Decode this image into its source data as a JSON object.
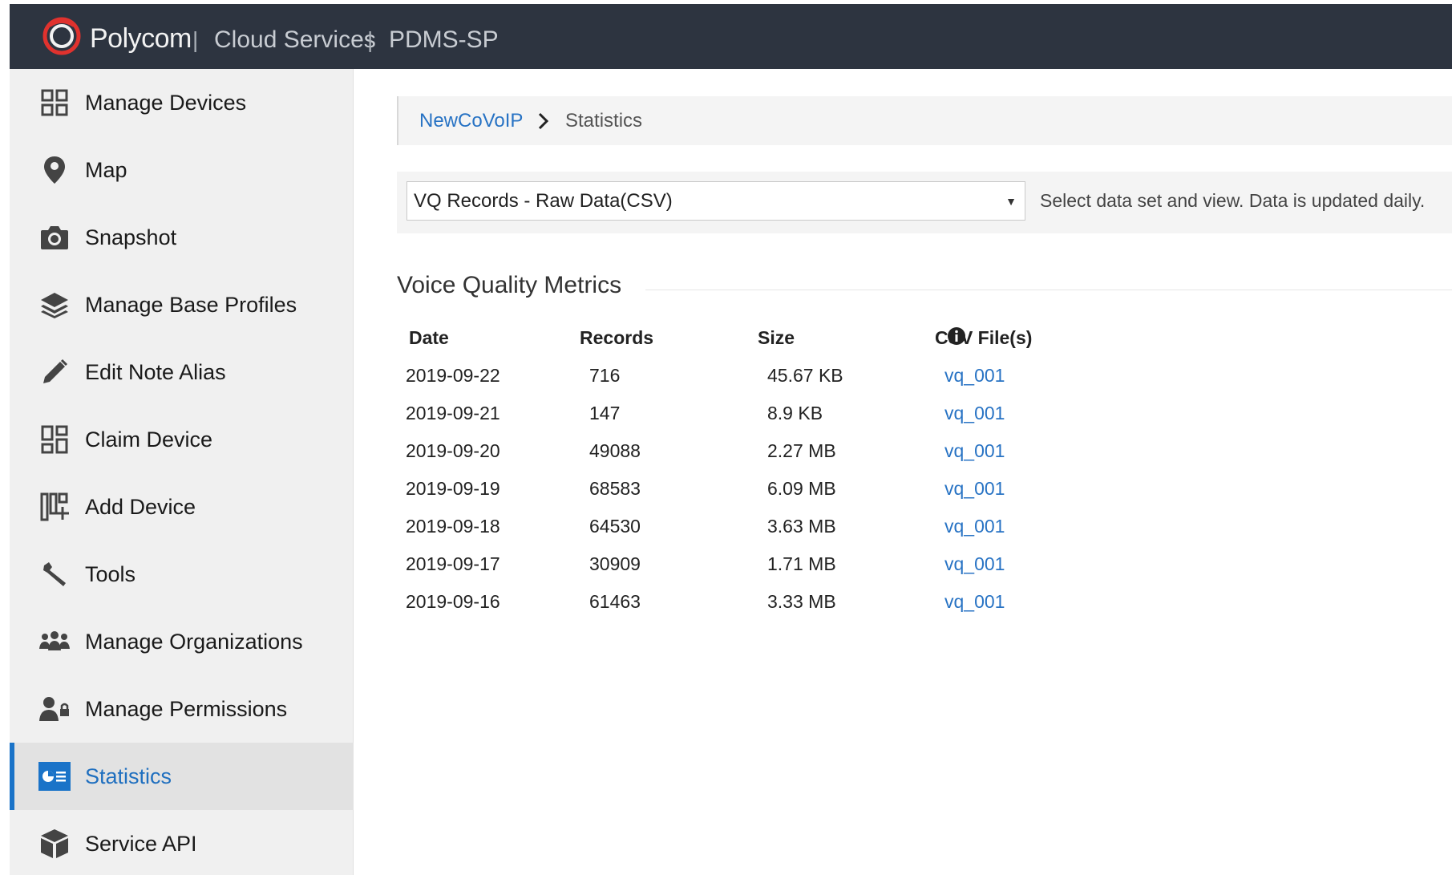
{
  "header": {
    "brand": "Polycom",
    "separator": "|",
    "product": "Cloud Services",
    "tenant": "PDMS-SP",
    "bg_color": "#2d3440"
  },
  "sidebar": {
    "items": [
      {
        "label": "Manage Devices",
        "icon": "grid-icon"
      },
      {
        "label": "Map",
        "icon": "map-pin-icon"
      },
      {
        "label": "Snapshot",
        "icon": "camera-icon"
      },
      {
        "label": "Manage Base Profiles",
        "icon": "layers-icon"
      },
      {
        "label": "Edit Note Alias",
        "icon": "pencil-icon"
      },
      {
        "label": "Claim Device",
        "icon": "claim-grid-icon"
      },
      {
        "label": "Add Device",
        "icon": "add-device-icon"
      },
      {
        "label": "Tools",
        "icon": "wrench-icon"
      },
      {
        "label": "Manage Organizations",
        "icon": "people-group-icon"
      },
      {
        "label": "Manage Permissions",
        "icon": "user-lock-icon"
      },
      {
        "label": "Statistics",
        "icon": "statistics-card-icon",
        "active": true
      },
      {
        "label": "Service API",
        "icon": "cube-icon"
      }
    ],
    "active_color": "#1a73c8"
  },
  "breadcrumb": {
    "parent": "NewCoVoIP",
    "current": "Statistics"
  },
  "dataset": {
    "selected": "VQ Records - Raw Data(CSV)",
    "hint": "Select data set and view. Data is updated daily."
  },
  "section": {
    "title": "Voice Quality Metrics"
  },
  "table": {
    "headers": {
      "date": "Date",
      "records": "Records",
      "size": "Size",
      "csv": "CSV File(s)"
    },
    "rows": [
      {
        "date": "2019-09-22",
        "records": "716",
        "size": "45.67 KB",
        "csv": "vq_001"
      },
      {
        "date": "2019-09-21",
        "records": "147",
        "size": "8.9 KB",
        "csv": "vq_001"
      },
      {
        "date": "2019-09-20",
        "records": "49088",
        "size": "2.27 MB",
        "csv": "vq_001"
      },
      {
        "date": "2019-09-19",
        "records": "68583",
        "size": "6.09 MB",
        "csv": "vq_001"
      },
      {
        "date": "2019-09-18",
        "records": "64530",
        "size": "3.63 MB",
        "csv": "vq_001"
      },
      {
        "date": "2019-09-17",
        "records": "30909",
        "size": "1.71 MB",
        "csv": "vq_001"
      },
      {
        "date": "2019-09-16",
        "records": "61463",
        "size": "3.33 MB",
        "csv": "vq_001"
      }
    ]
  }
}
